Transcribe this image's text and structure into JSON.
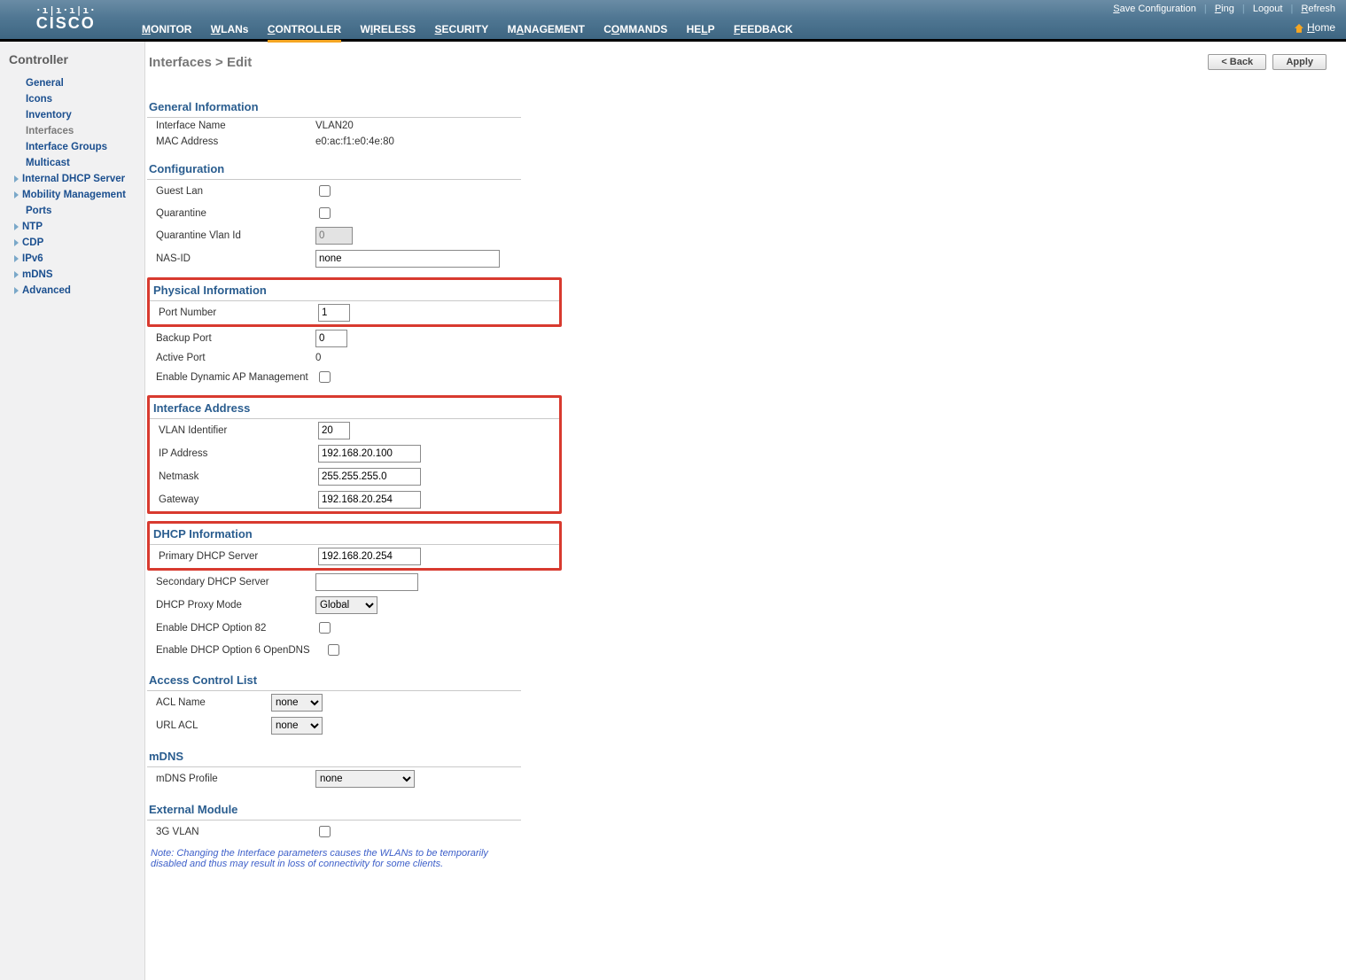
{
  "brand": "CISCO",
  "topbar": {
    "save": "Save Configuration",
    "ping": "Ping",
    "logout": "Logout",
    "refresh": "Refresh",
    "home": "Home"
  },
  "nav": {
    "monitor": "MONITOR",
    "wlans": "WLANs",
    "controller": "CONTROLLER",
    "wireless": "WIRELESS",
    "security": "SECURITY",
    "management": "MANAGEMENT",
    "commands": "COMMANDS",
    "help": "HELP",
    "feedback": "FEEDBACK"
  },
  "sidebar": {
    "title": "Controller",
    "items": {
      "general": "General",
      "icons": "Icons",
      "inventory": "Inventory",
      "interfaces": "Interfaces",
      "interface_groups": "Interface Groups",
      "multicast": "Multicast",
      "internal_dhcp": "Internal DHCP Server",
      "mobility": "Mobility Management",
      "ports": "Ports",
      "ntp": "NTP",
      "cdp": "CDP",
      "ipv6": "IPv6",
      "mdns": "mDNS",
      "advanced": "Advanced"
    }
  },
  "page": {
    "breadcrumb": "Interfaces > Edit",
    "buttons": {
      "back": "< Back",
      "apply": "Apply"
    }
  },
  "sections": {
    "general": {
      "title": "General Information",
      "interface_name_lbl": "Interface Name",
      "interface_name_val": "VLAN20",
      "mac_lbl": "MAC Address",
      "mac_val": "e0:ac:f1:e0:4e:80"
    },
    "config": {
      "title": "Configuration",
      "guest_lan_lbl": "Guest Lan",
      "quarantine_lbl": "Quarantine",
      "quarantine_vlan_lbl": "Quarantine Vlan Id",
      "quarantine_vlan_val": "0",
      "nas_id_lbl": "NAS-ID",
      "nas_id_val": "none"
    },
    "physical": {
      "title": "Physical Information",
      "port_number_lbl": "Port Number",
      "port_number_val": "1",
      "backup_port_lbl": "Backup Port",
      "backup_port_val": "0",
      "active_port_lbl": "Active Port",
      "active_port_val": "0",
      "dyn_ap_lbl": "Enable Dynamic AP Management"
    },
    "iface_addr": {
      "title": "Interface Address",
      "vlan_id_lbl": "VLAN Identifier",
      "vlan_id_val": "20",
      "ip_lbl": "IP Address",
      "ip_val": "192.168.20.100",
      "netmask_lbl": "Netmask",
      "netmask_val": "255.255.255.0",
      "gateway_lbl": "Gateway",
      "gateway_val": "192.168.20.254"
    },
    "dhcp": {
      "title": "DHCP Information",
      "primary_lbl": "Primary DHCP Server",
      "primary_val": "192.168.20.254",
      "secondary_lbl": "Secondary DHCP Server",
      "secondary_val": "",
      "proxy_lbl": "DHCP Proxy Mode",
      "proxy_val": "Global",
      "opt82_lbl": "Enable DHCP Option 82",
      "opt6_lbl": "Enable DHCP Option 6 OpenDNS"
    },
    "acl": {
      "title": "Access Control List",
      "acl_name_lbl": "ACL Name",
      "acl_name_val": "none",
      "url_acl_lbl": "URL ACL",
      "url_acl_val": "none"
    },
    "mdns": {
      "title": "mDNS",
      "profile_lbl": "mDNS Profile",
      "profile_val": "none"
    },
    "ext": {
      "title": "External Module",
      "vlan3g_lbl": "3G VLAN"
    },
    "note": "Note: Changing the Interface parameters causes the WLANs to be temporarily disabled and thus may result in loss of connectivity for some clients."
  }
}
